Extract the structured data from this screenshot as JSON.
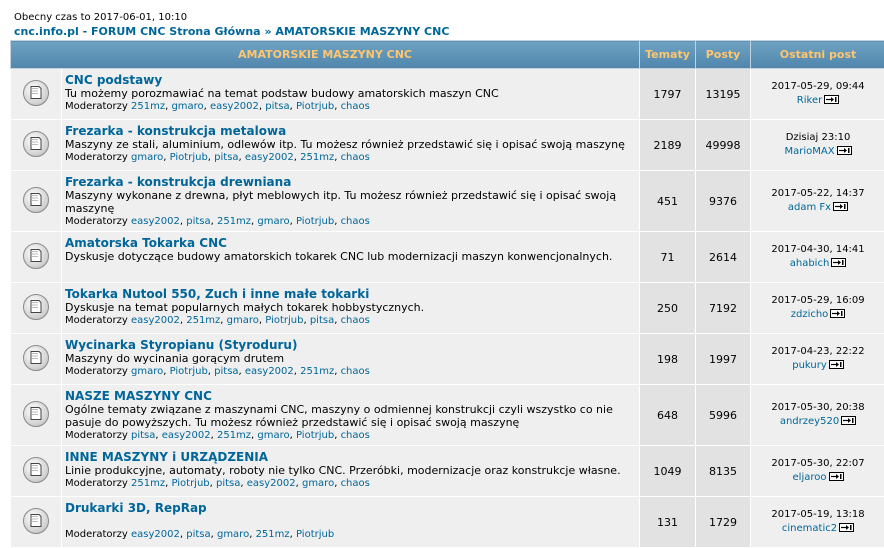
{
  "header": {
    "time": "Obecny czas to 2017-06-01, 10:10",
    "breadcrumb_site": "cnc.info.pl - FORUM CNC Strona Główna",
    "breadcrumb_sep": "»",
    "breadcrumb_current": "AMATORSKIE MASZYNY CNC"
  },
  "table": {
    "col_forum": "AMATORSKIE MASZYNY CNC",
    "col_topics": "Tematy",
    "col_posts": "Posty",
    "col_last": "Ostatni post"
  },
  "mods_label": "Moderatorzy",
  "forums": [
    {
      "name": "CNC podstawy",
      "desc": "Tu możemy porozmawiać na temat podstaw budowy amatorskich maszyn CNC",
      "mods": [
        "251mz",
        "gmaro",
        "easy2002",
        "pitsa",
        "Piotrjub",
        "chaos"
      ],
      "topics": "1797",
      "posts": "13195",
      "last_date": "2017-05-29, 09:44",
      "last_user": "Riker"
    },
    {
      "name": "Frezarka - konstrukcja metalowa",
      "desc": "Maszyny ze stali, aluminium, odlewów itp. Tu możesz również przedstawić się i opisać swoją maszynę",
      "mods": [
        "gmaro",
        "Piotrjub",
        "pitsa",
        "easy2002",
        "251mz",
        "chaos"
      ],
      "topics": "2189",
      "posts": "49998",
      "last_date": "Dzisiaj 23:10",
      "last_user": "MarioMAX"
    },
    {
      "name": "Frezarka - konstrukcja drewniana",
      "desc": "Maszyny wykonane z drewna, płyt meblowych itp. Tu możesz również przedstawić się i opisać swoją maszynę",
      "mods": [
        "easy2002",
        "pitsa",
        "251mz",
        "gmaro",
        "Piotrjub",
        "chaos"
      ],
      "topics": "451",
      "posts": "9376",
      "last_date": "2017-05-22, 14:37",
      "last_user": "adam Fx"
    },
    {
      "name": "Amatorska Tokarka CNC",
      "desc": "Dyskusje dotyczące budowy amatorskich tokarek CNC lub modernizacji maszyn konwencjonalnych.",
      "mods": [],
      "topics": "71",
      "posts": "2614",
      "last_date": "2017-04-30, 14:41",
      "last_user": "ahabich"
    },
    {
      "name": "Tokarka Nutool 550, Zuch i inne małe tokarki",
      "desc": "Dyskusje na temat popularnych małych tokarek hobbystycznych.",
      "mods": [
        "easy2002",
        "251mz",
        "gmaro",
        "Piotrjub",
        "pitsa",
        "chaos"
      ],
      "topics": "250",
      "posts": "7192",
      "last_date": "2017-05-29, 16:09",
      "last_user": "zdzicho"
    },
    {
      "name": "Wycinarka Styropianu (Styroduru)",
      "desc": "Maszyny do wycinania gorącym drutem",
      "mods": [
        "gmaro",
        "Piotrjub",
        "pitsa",
        "easy2002",
        "251mz",
        "chaos"
      ],
      "topics": "198",
      "posts": "1997",
      "last_date": "2017-04-23, 22:22",
      "last_user": "pukury"
    },
    {
      "name": "NASZE MASZYNY CNC",
      "desc": "Ogólne tematy związane z maszynami CNC, maszyny o odmiennej konstrukcji czyli wszystko co nie pasuje do powyższych. Tu możesz również przedstawić się i opisać swoją maszynę",
      "mods": [
        "pitsa",
        "easy2002",
        "251mz",
        "gmaro",
        "Piotrjub",
        "chaos"
      ],
      "topics": "648",
      "posts": "5996",
      "last_date": "2017-05-30, 20:38",
      "last_user": "andrzey520"
    },
    {
      "name": "INNE MASZYNY i URZĄDZENIA",
      "desc": "Linie produkcyjne, automaty, roboty nie tylko CNC. Przeróbki, modernizacje oraz konstrukcje własne.",
      "mods": [
        "251mz",
        "Piotrjub",
        "pitsa",
        "easy2002",
        "gmaro",
        "chaos"
      ],
      "topics": "1049",
      "posts": "8135",
      "last_date": "2017-05-30, 22:07",
      "last_user": "eljaroo"
    },
    {
      "name": "Drukarki 3D, RepRap",
      "desc": "",
      "mods": [
        "easy2002",
        "pitsa",
        "gmaro",
        "251mz",
        "Piotrjub"
      ],
      "topics": "131",
      "posts": "1729",
      "last_date": "2017-05-19, 13:18",
      "last_user": "cinematic2"
    }
  ]
}
